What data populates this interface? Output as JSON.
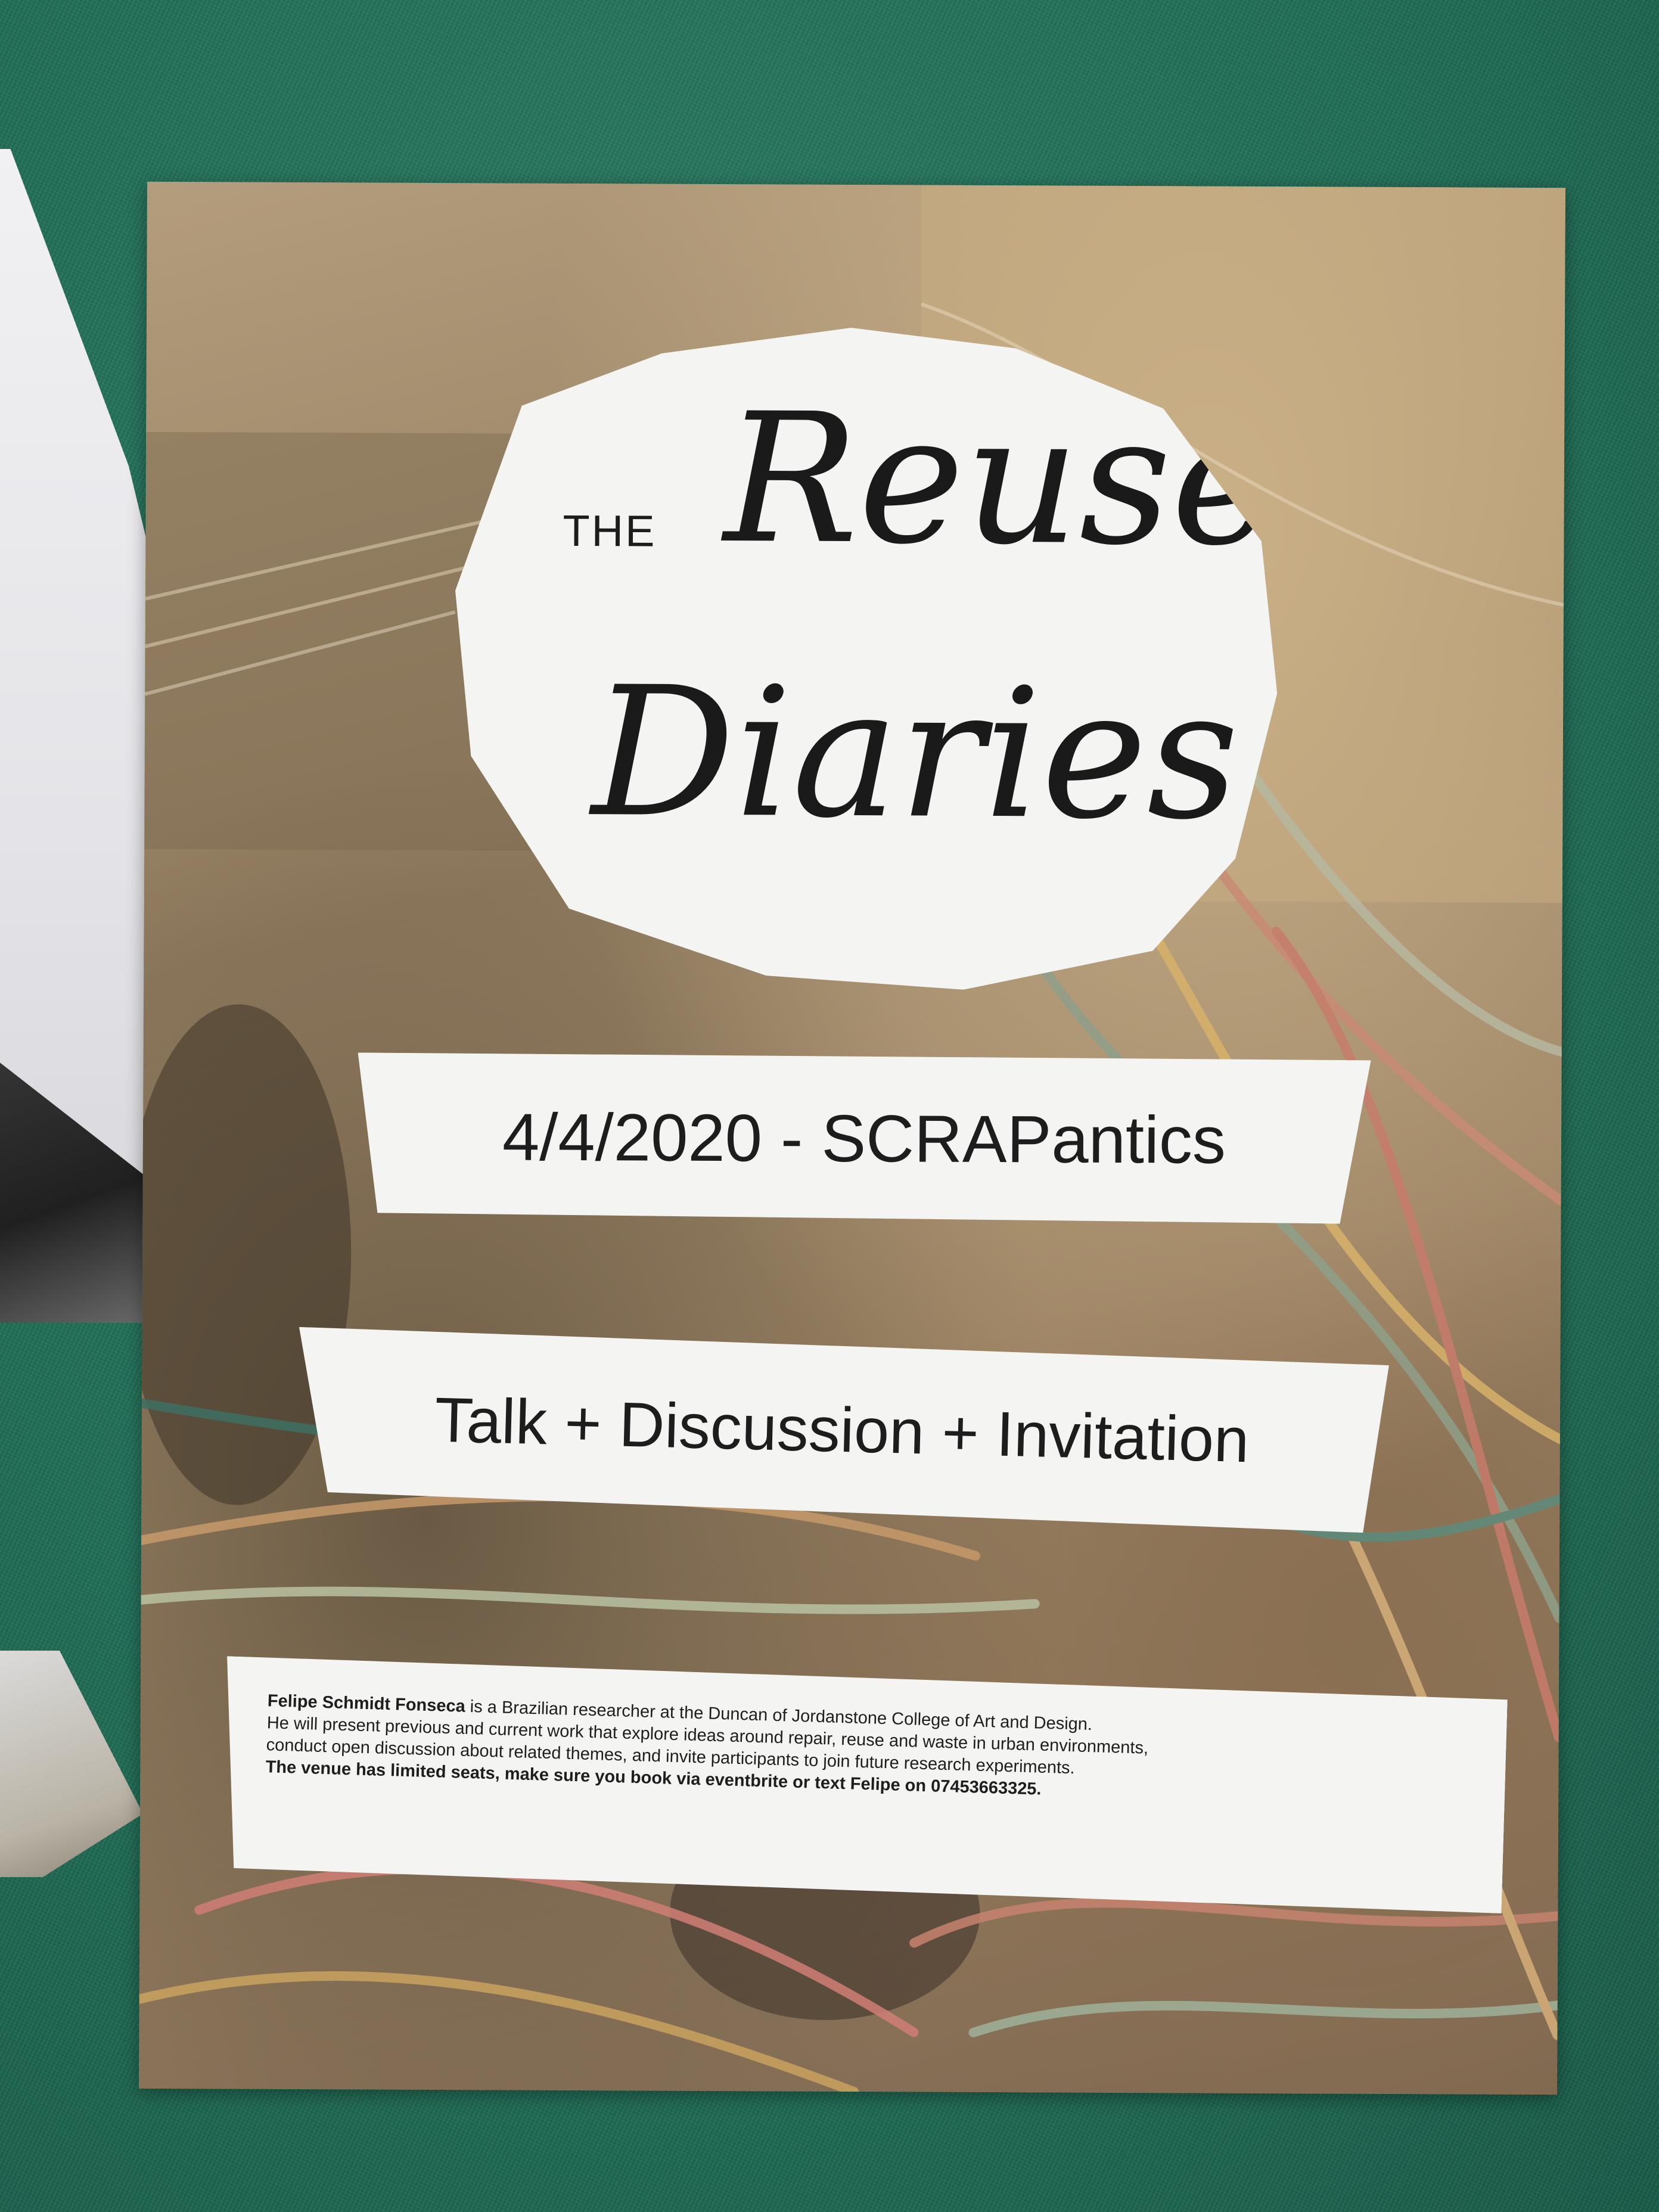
{
  "poster": {
    "title_the": "THE",
    "title_reuse": "Reuse",
    "title_diaries": "Diaries",
    "date_venue": "4/4/2020 - SCRAPantics",
    "event_format": "Talk + Discussion + Invitation",
    "info": {
      "name": "Felipe Schmidt Fonseca",
      "intro_rest": " is a Brazilian researcher at the Duncan of Jordanstone College of Art and Design.",
      "line2": "He will present previous and current work that explore ideas around repair, reuse and waste in urban environments,",
      "line3": "conduct open discussion about related themes, and invite participants to join future research experiments.",
      "booking": "The venue has limited seats, make sure you book via eventbrite or text Felipe on 07453663325."
    }
  },
  "colors": {
    "board": "#1f6e57",
    "paper": "#f4f4f2",
    "text": "#1a1a1a"
  }
}
